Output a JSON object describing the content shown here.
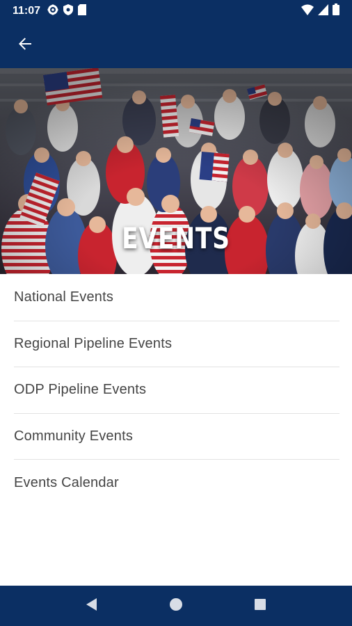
{
  "status_bar": {
    "time": "11:07",
    "left_icons": [
      "gear-icon",
      "shield-icon",
      "sim-card-icon"
    ],
    "right_icons": [
      "wifi-icon",
      "cell-signal-icon",
      "battery-icon"
    ]
  },
  "app_bar": {
    "back_icon": "arrow-left-icon",
    "bg_color": "#0b2f63"
  },
  "hero": {
    "title": "EVENTS",
    "image": "crowd of USA fans waving american flags"
  },
  "menu": {
    "items": [
      {
        "label": "National Events"
      },
      {
        "label": "Regional Pipeline Events"
      },
      {
        "label": "ODP Pipeline Events"
      },
      {
        "label": "Community Events"
      },
      {
        "label": "Events Calendar"
      }
    ]
  },
  "nav_bar": {
    "icons": [
      "back-triangle-icon",
      "home-circle-icon",
      "recents-square-icon"
    ]
  }
}
